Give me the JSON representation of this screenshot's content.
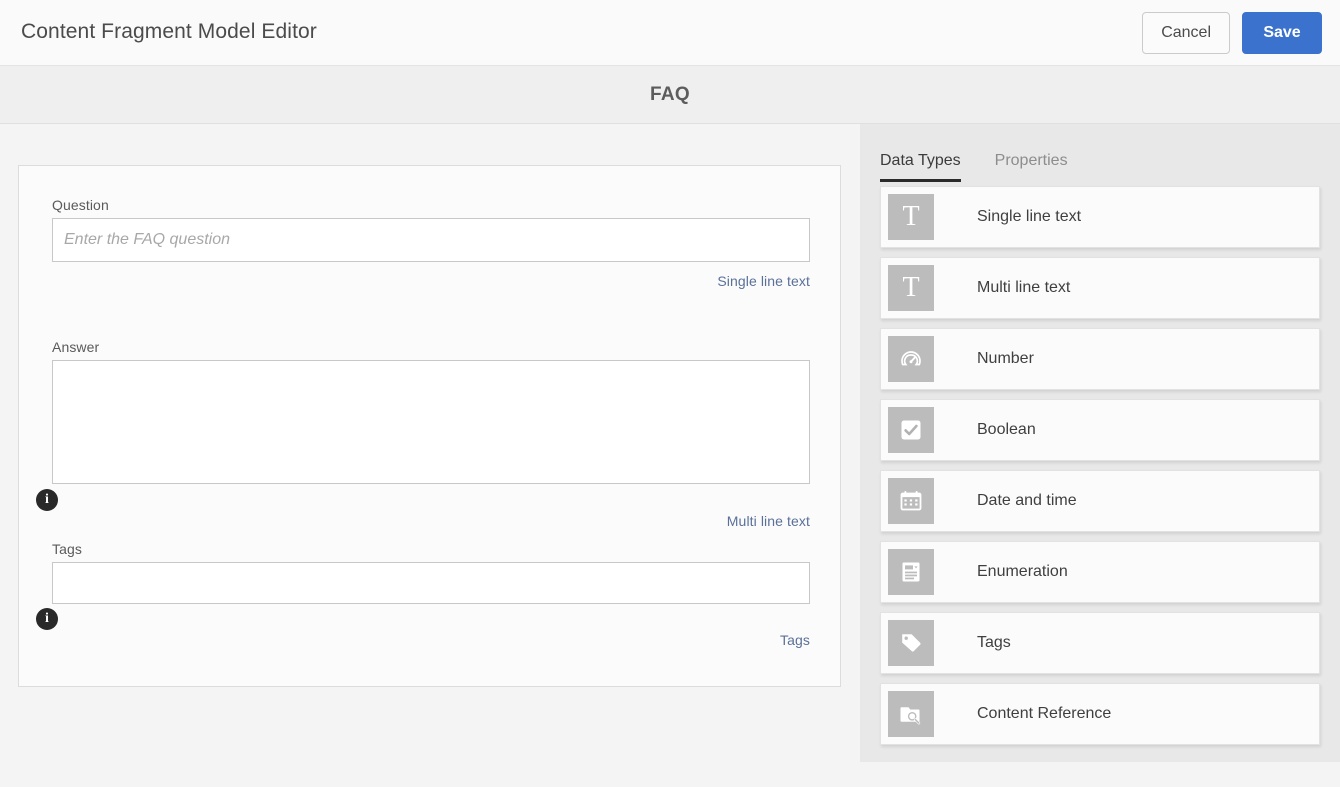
{
  "header": {
    "app_title": "Content Fragment Model Editor",
    "cancel_label": "Cancel",
    "save_label": "Save",
    "save_color": "#3b72cd"
  },
  "model": {
    "name": "FAQ"
  },
  "form": {
    "fields": [
      {
        "label": "Question",
        "placeholder": "Enter the FAQ question",
        "value": "",
        "type_hint": "Single line text",
        "control": "input",
        "has_info": false
      },
      {
        "label": "Answer",
        "placeholder": "",
        "value": "",
        "type_hint": "Multi line text",
        "control": "textarea",
        "has_info": true
      },
      {
        "label": "Tags",
        "placeholder": "",
        "value": "",
        "type_hint": "Tags",
        "control": "tagsbox",
        "has_info": true
      }
    ],
    "info_glyph": "i",
    "hint_color": "#5a7099"
  },
  "rail": {
    "tabs": [
      {
        "label": "Data Types",
        "active": true
      },
      {
        "label": "Properties",
        "active": false
      }
    ],
    "data_types": [
      {
        "label": "Single line text",
        "icon": "single-line-text-icon"
      },
      {
        "label": "Multi line text",
        "icon": "multi-line-text-icon"
      },
      {
        "label": "Number",
        "icon": "gauge-icon"
      },
      {
        "label": "Boolean",
        "icon": "checkbox-icon"
      },
      {
        "label": "Date and time",
        "icon": "calendar-icon"
      },
      {
        "label": "Enumeration",
        "icon": "enumeration-list-icon"
      },
      {
        "label": "Tags",
        "icon": "tag-icon"
      },
      {
        "label": "Content Reference",
        "icon": "folder-search-icon"
      }
    ]
  }
}
